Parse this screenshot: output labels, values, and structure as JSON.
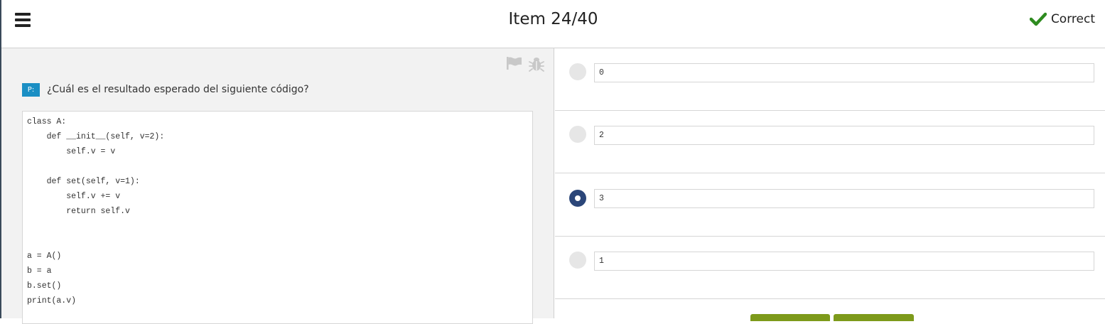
{
  "header": {
    "menu_icon": "hamburger-menu-icon",
    "title": "Item 24/40",
    "status_icon": "check-icon",
    "status_label": "Correct",
    "status_color": "#2e8b1f"
  },
  "toolbar": {
    "flag_icon": "flag-icon",
    "bug_icon": "bug-icon"
  },
  "question": {
    "badge": "P:",
    "badge_color": "#1b8fc4",
    "text": "¿Cuál es el resultado esperado del siguiente código?",
    "code_lines": [
      "class A:",
      "    def __init__(self, v=2):",
      "        self.v = v",
      "",
      "    def set(self, v=1):",
      "        self.v += v",
      "        return self.v",
      "",
      "",
      "a = A()",
      "b = a",
      "b.set()",
      "print(a.v)"
    ]
  },
  "options": [
    {
      "value": "0",
      "selected": false
    },
    {
      "value": "2",
      "selected": false
    },
    {
      "value": "3",
      "selected": true
    },
    {
      "value": "1",
      "selected": false
    }
  ],
  "colors": {
    "selected_radio": "#2b4679",
    "button": "#7d9a1b"
  }
}
